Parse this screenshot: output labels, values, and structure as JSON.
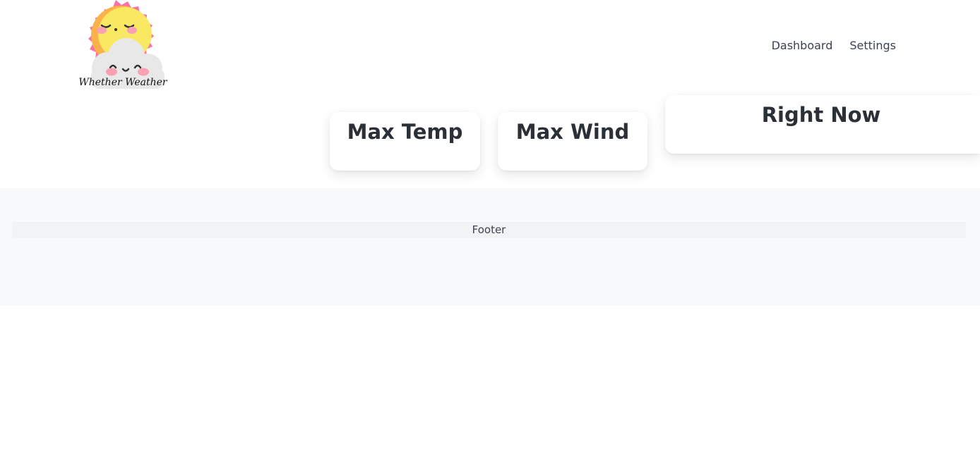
{
  "brand": {
    "logo_text": "Whether Weather",
    "logo_icon": "sun-and-cloud-logo",
    "colors": {
      "sun_rays": "#ff6fa4",
      "sun_face": "#f8e862",
      "sun_shade": "#fbb24a",
      "cloud": "#e8e8e8",
      "cheeks": "#f9a0b3"
    }
  },
  "nav": {
    "items": [
      {
        "label": "Dashboard"
      },
      {
        "label": "Settings"
      }
    ]
  },
  "cards": {
    "max_temp": {
      "title": "Max Temp"
    },
    "max_wind": {
      "title": "Max Wind"
    },
    "right_now": {
      "title": "Right Now"
    }
  },
  "footer": {
    "label": "Footer"
  }
}
